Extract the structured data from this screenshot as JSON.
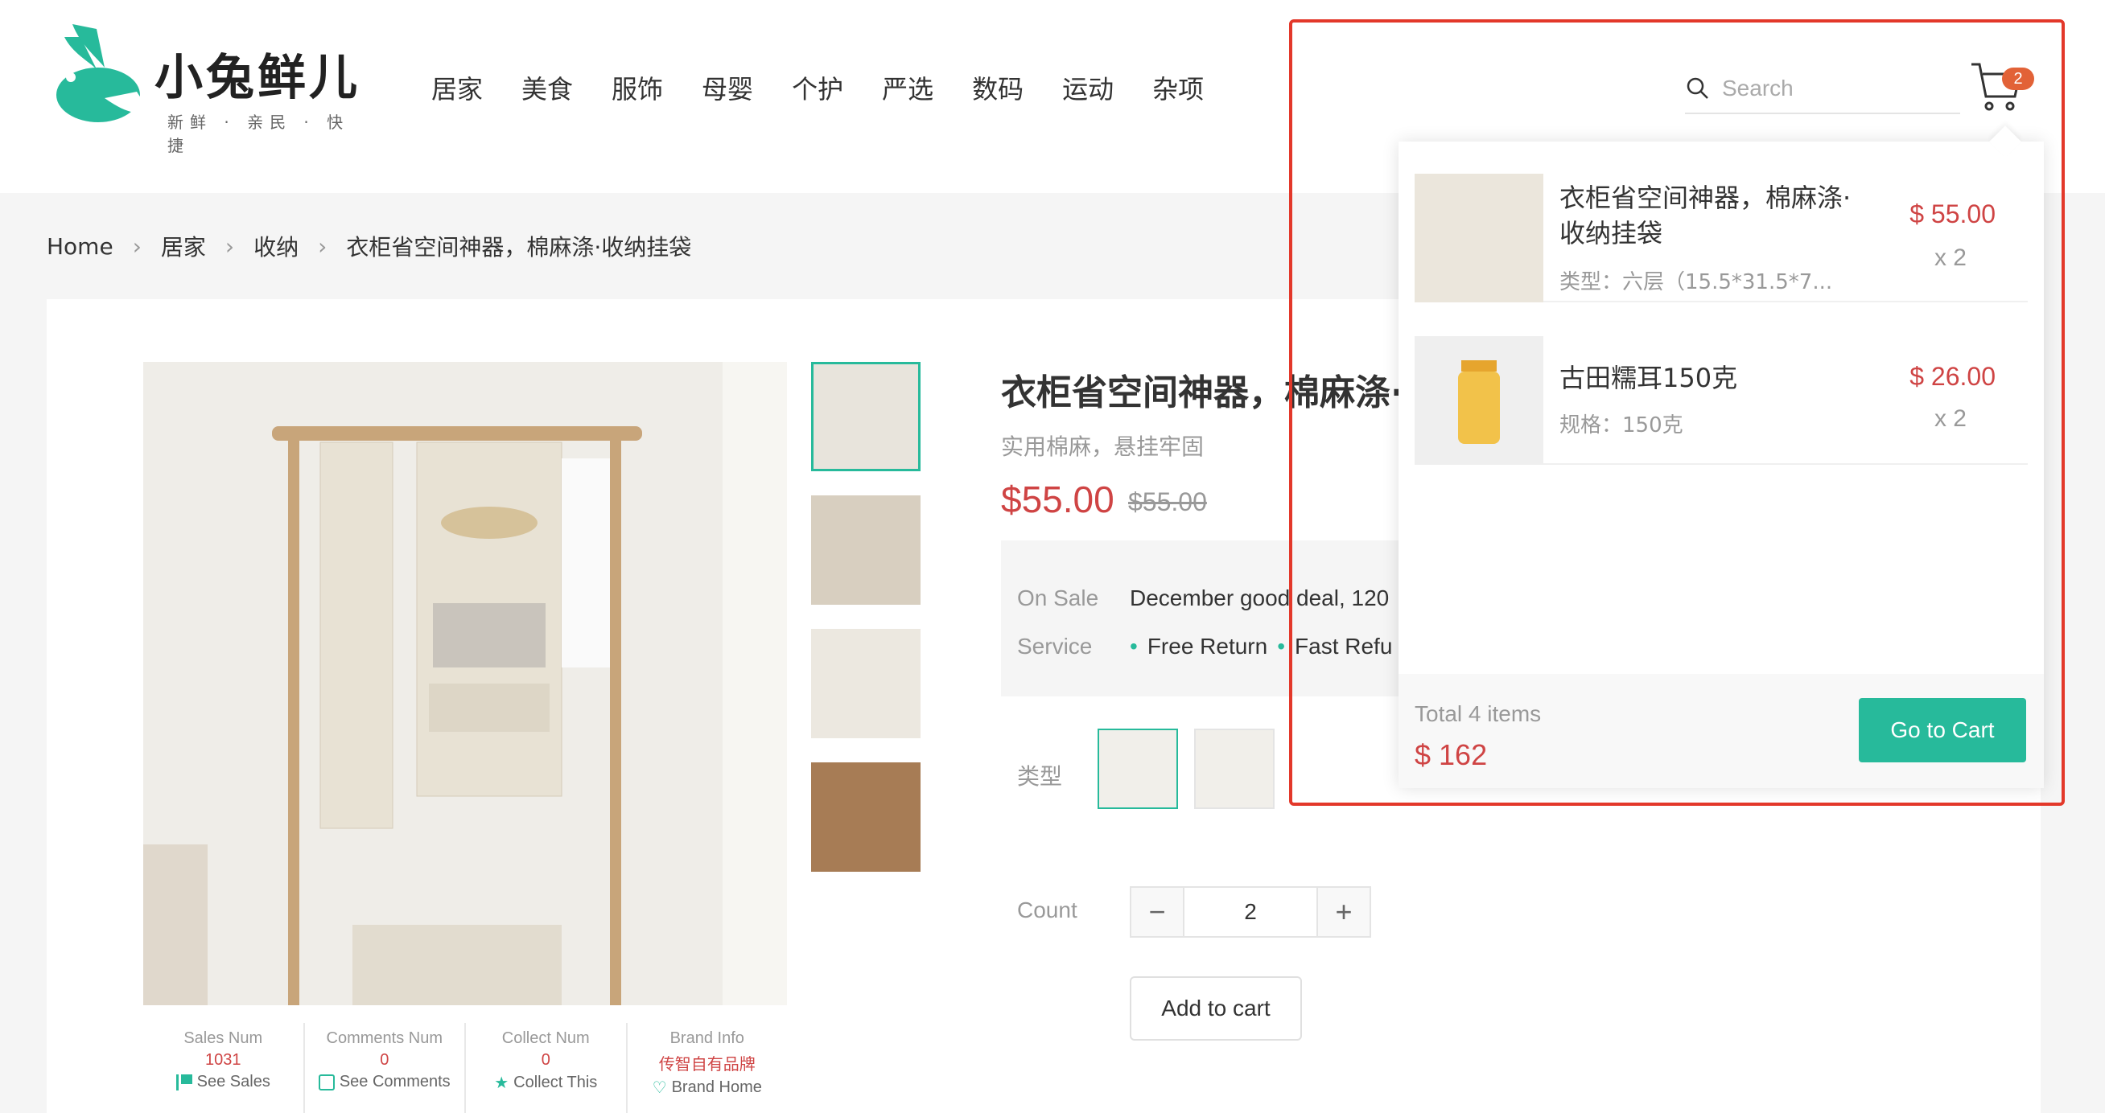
{
  "brand": {
    "name": "小兔鲜儿",
    "tagline": "新鲜 · 亲民 · 快捷",
    "color": "#27ba9b"
  },
  "nav": [
    "居家",
    "美食",
    "服饰",
    "母婴",
    "个护",
    "严选",
    "数码",
    "运动",
    "杂项"
  ],
  "search": {
    "placeholder": "Search"
  },
  "cart": {
    "count": "2"
  },
  "breadcrumb": [
    "Home",
    "居家",
    "收纳",
    "衣柜省空间神器，棉麻涤·收纳挂袋"
  ],
  "product": {
    "name": "衣柜省空间神器，棉麻涤·收纳挂袋",
    "desc": "实用棉麻，悬挂牢固",
    "price": "$55.00",
    "old_price": "$55.00",
    "sale_label": "On Sale",
    "sale_text": "December good deal, 120",
    "service_label": "Service",
    "services": [
      "Free Return",
      "Fast Refu"
    ],
    "type_label": "类型",
    "count_label": "Count",
    "count": "2",
    "add_to_cart": "Add to cart"
  },
  "stats": [
    {
      "label": "Sales Num",
      "value": "1031",
      "link": "See Sales",
      "icon": "flag-icon"
    },
    {
      "label": "Comments Num",
      "value": "0",
      "link": "See Comments",
      "icon": "comment-icon"
    },
    {
      "label": "Collect Num",
      "value": "0",
      "link": "Collect This",
      "icon": "star-icon"
    },
    {
      "label": "Brand Info",
      "value": "传智自有品牌",
      "link": "Brand Home",
      "icon": "heart-icon"
    }
  ],
  "dropdown": {
    "items": [
      {
        "name": "衣柜省空间神器，棉麻涤·收纳挂袋",
        "attr": "类型：六层（15.5*31.5*7...",
        "price": "$ 55.00",
        "qty": "x 2"
      },
      {
        "name": "古田糯耳150克",
        "attr": "规格：150克",
        "price": "$ 26.00",
        "qty": "x 2"
      }
    ],
    "total_label": "Total 4 items",
    "total": "$ 162",
    "go_cart": "Go to Cart"
  },
  "colors": {
    "accent": "#27ba9b",
    "price": "#cf4444",
    "highlight_box": "#e3382a",
    "badge": "#e26237"
  }
}
